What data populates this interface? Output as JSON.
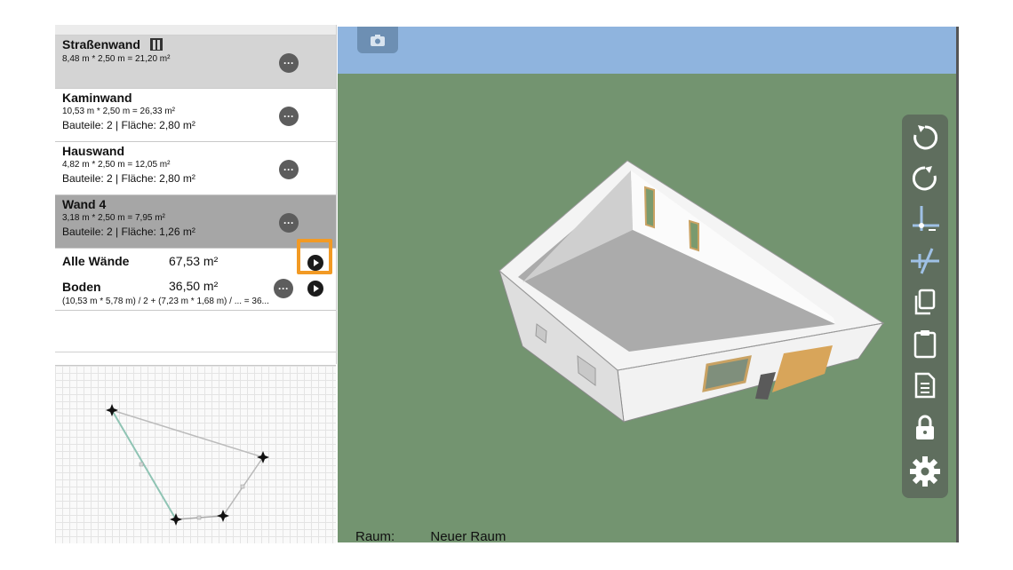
{
  "walls": [
    {
      "name": "Straßenwand",
      "dims": "8,48 m * 2,50 m = 21,20 m²",
      "parts": ""
    },
    {
      "name": "Kaminwand",
      "dims": "10,53 m * 2,50 m = 26,33 m²",
      "parts": "Bauteile: 2 | Fläche: 2,80 m²"
    },
    {
      "name": "Hauswand",
      "dims": "4,82 m * 2,50 m = 12,05 m²",
      "parts": "Bauteile: 2 | Fläche: 2,80 m²"
    },
    {
      "name": "Wand 4",
      "dims": "3,18 m * 2,50 m = 7,95 m²",
      "parts": "Bauteile: 2 | Fläche: 1,26 m²"
    }
  ],
  "more_label": "···",
  "all_walls": {
    "label": "Alle Wände",
    "area": "67,53 m²"
  },
  "floor": {
    "label": "Boden",
    "area": "36,50 m²",
    "formula": "(10,53 m * 5,78 m) / 2 + (7,23 m * 1,68 m) / ... = 36..."
  },
  "status": {
    "label": "Raum:",
    "value": "Neuer Raum"
  },
  "colors": {
    "highlight": "#f29a24",
    "grass": "#739470",
    "sky": "#8fb4de",
    "toolbar": "#5f6e5e"
  },
  "icons": {
    "camera": "camera-icon",
    "toolbar": [
      "undo-icon",
      "redo-icon",
      "add-corner-icon",
      "split-wall-icon",
      "copy-icon",
      "paste-icon",
      "document-icon",
      "lock-icon",
      "settings-gear-icon"
    ]
  }
}
